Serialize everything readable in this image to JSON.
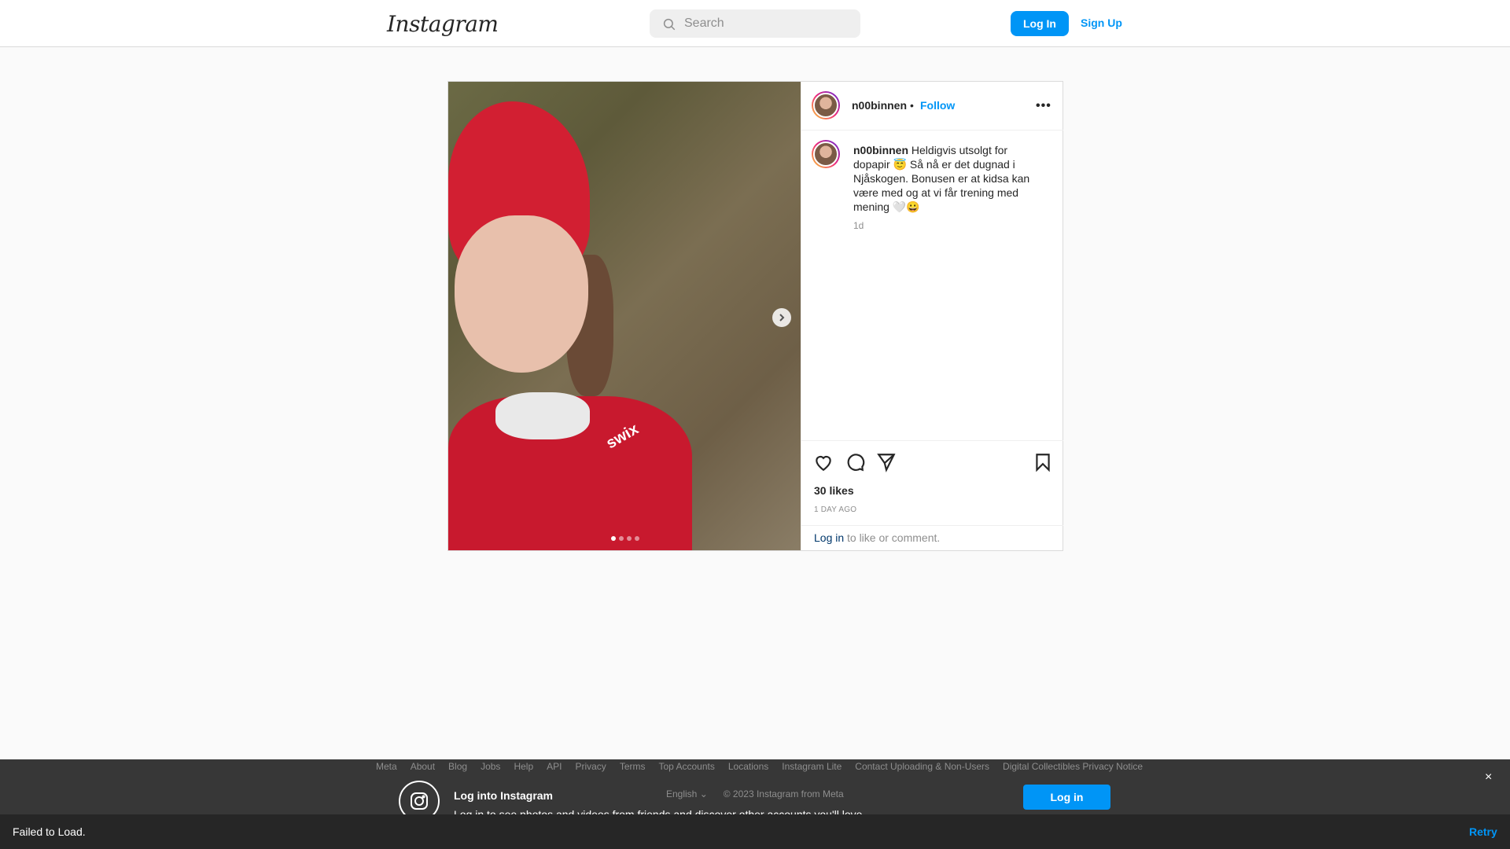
{
  "nav": {
    "logo": "Instagram",
    "search_placeholder": "Search",
    "login_label": "Log In",
    "signup_label": "Sign Up"
  },
  "post": {
    "username": "n00binnen",
    "bullet": "•",
    "follow_label": "Follow",
    "more_label": "•••",
    "caption": "Heldigvis utsolgt for dopapir 😇 Så nå er det dugnad i Njåskogen. Bonusen er at kidsa kan være med og at vi får trening med mening 🤍😀",
    "caption_time": "1d",
    "likes": "30 likes",
    "posted_ago": "1 DAY AGO",
    "login_link": "Log in",
    "login_suffix": "to like or comment.",
    "photo_brand": "swix",
    "carousel_count": 4,
    "carousel_active": 1
  },
  "footer": {
    "links": [
      "Meta",
      "About",
      "Blog",
      "Jobs",
      "Help",
      "API",
      "Privacy",
      "Terms",
      "Top Accounts",
      "Locations",
      "Instagram Lite",
      "Contact Uploading & Non-Users",
      "Digital Collectibles Privacy Notice"
    ],
    "language": "English",
    "copyright": "© 2023 Instagram from Meta"
  },
  "banner": {
    "title": "Log into Instagram",
    "subtitle": "Log in to see photos and videos from friends and discover other accounts you'll love.",
    "login_label": "Log in",
    "close_label": "×"
  },
  "error": {
    "message": "Failed to Load.",
    "retry_label": "Retry"
  },
  "colors": {
    "accent": "#0095f6",
    "text": "#262626",
    "muted": "#8e8e8e",
    "link_dark": "#00376b"
  }
}
